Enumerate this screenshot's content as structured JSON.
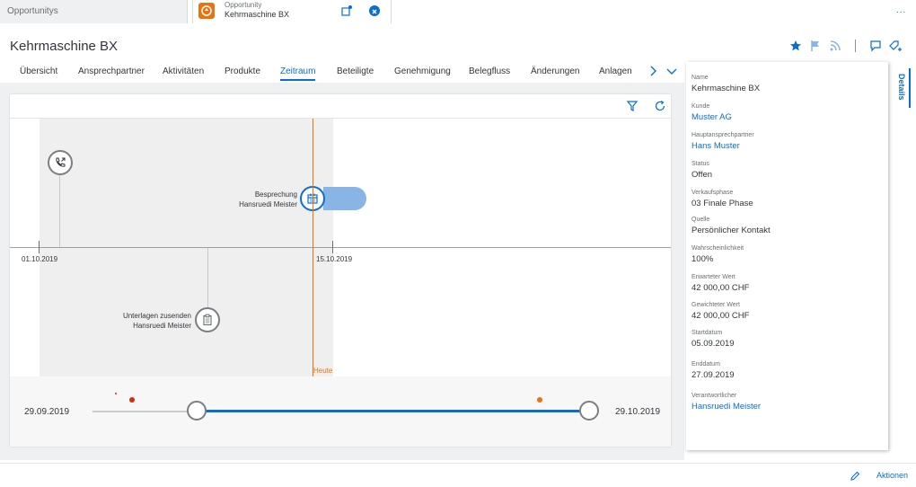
{
  "tabs": {
    "tab1_label": "Opportunitys",
    "tab2_type": "Opportunity",
    "tab2_label": "Kehrmaschine BX",
    "more_label": "..."
  },
  "header": {
    "title": "Kehrmaschine BX",
    "icons": [
      "star-icon",
      "flag-icon",
      "feed-icon",
      "comment-icon",
      "tag-icon"
    ]
  },
  "nav": {
    "tabs": [
      "Übersicht",
      "Ansprechpartner",
      "Aktivitäten",
      "Produkte",
      "Zeitraum",
      "Beteiligte",
      "Genehmigung",
      "Belegfluss",
      "Änderungen",
      "Anlagen"
    ],
    "active": "Zeitraum"
  },
  "timeline": {
    "tick_start": "01.10.2019",
    "tick_mid": "15.10.2019",
    "today_label": "Heute",
    "events": [
      {
        "icon": "phone-outgoing-icon",
        "line1": "",
        "line2": ""
      },
      {
        "icon": "calendar-icon",
        "line1": "Besprechung",
        "line2": "Hansruedi Meister"
      },
      {
        "icon": "clipboard-icon",
        "line1": "Unterlagen zusenden",
        "line2": "Hansruedi Meister"
      }
    ]
  },
  "range": {
    "start_date": "29.09.2019",
    "end_date": "29.10.2019"
  },
  "details": {
    "tab_label": "Details",
    "fields": [
      {
        "label": "Name",
        "value": "Kehrmaschine BX",
        "link": false
      },
      {
        "label": "Kunde",
        "value": "Muster AG",
        "link": true
      },
      {
        "label": "Hauptansprechpartner",
        "value": "Hans Muster",
        "link": true
      },
      {
        "label": "Status",
        "value": "Offen",
        "link": false
      },
      {
        "label": "Verkaufsphase",
        "value": "03 Finale Phase",
        "link": false
      },
      {
        "label": "Quelle",
        "value": "Persönlicher Kontakt",
        "link": false
      },
      {
        "label": "Wahrscheinlichkeit",
        "value": "100%",
        "link": false
      },
      {
        "label": "Erwarteter Wert",
        "value": "42 000,00 CHF",
        "link": false
      },
      {
        "label": "Gewichteter Wert",
        "value": "42 000,00 CHF",
        "link": false
      },
      {
        "label": "Startdatum",
        "value": "05.09.2019",
        "link": false
      },
      {
        "label": "Enddatum",
        "value": "27.09.2019",
        "link": false
      },
      {
        "label": "Verantwortlicher",
        "value": "Hansruedi Meister",
        "link": true
      }
    ]
  },
  "footer": {
    "actions_label": "Aktionen"
  },
  "colors": {
    "accent": "#0a6ed1",
    "today": "#e9730c",
    "event_bar": "#89b4e6",
    "dot_red": "#d9290e",
    "dot_orange": "#e9730c"
  }
}
